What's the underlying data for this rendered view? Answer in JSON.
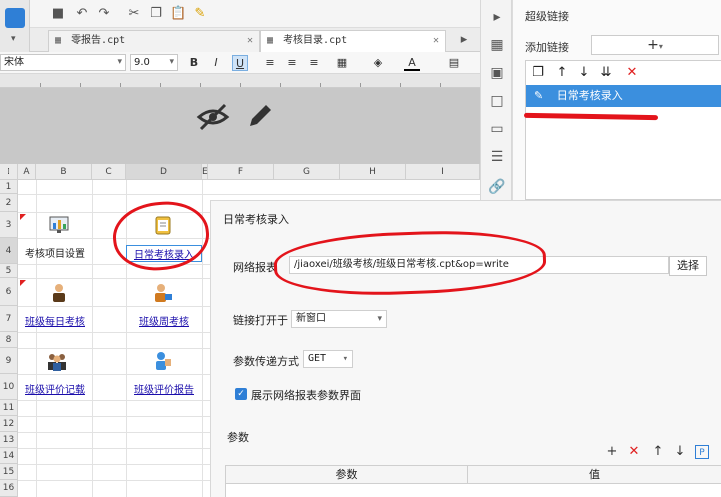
{
  "tabs": [
    {
      "label": "零报告.cpt",
      "active": false
    },
    {
      "label": "考核目录.cpt",
      "active": true
    }
  ],
  "format": {
    "font_family": "宋体",
    "font_size": "9.0"
  },
  "columns": [
    "A",
    "B",
    "C",
    "D",
    "E",
    "F",
    "G",
    "H",
    "I"
  ],
  "rows": [
    "1",
    "2",
    "3",
    "4",
    "5",
    "6",
    "7",
    "8",
    "9",
    "10",
    "11",
    "12",
    "13",
    "14",
    "15",
    "16"
  ],
  "cells": {
    "b4": "考核项目设置",
    "d4": "日常考核录入",
    "b7": "班级每日考核",
    "d7": "班级周考核",
    "b10": "班级评价记载",
    "d10": "班级评价报告"
  },
  "hyperlink": {
    "title": "超级链接",
    "add_label": "添加链接",
    "add_button": "+",
    "items": [
      "日常考核录入"
    ]
  },
  "config": {
    "title": "日常考核录入",
    "report_label": "网络报表",
    "report_path": "/jiaoxei/班级考核/班级日常考核.cpt&op=write",
    "choose_button": "选择",
    "open_in_label": "链接打开于",
    "open_in_value": "新窗口",
    "param_method_label": "参数传递方式",
    "param_method_value": "GET",
    "show_params_label": "展示网络报表参数界面",
    "params_label": "参数",
    "col_param": "参数",
    "col_value": "值"
  },
  "colors": {
    "annotation": "#e3141b",
    "selection": "#3b8fde",
    "link": "#1a0dab"
  }
}
